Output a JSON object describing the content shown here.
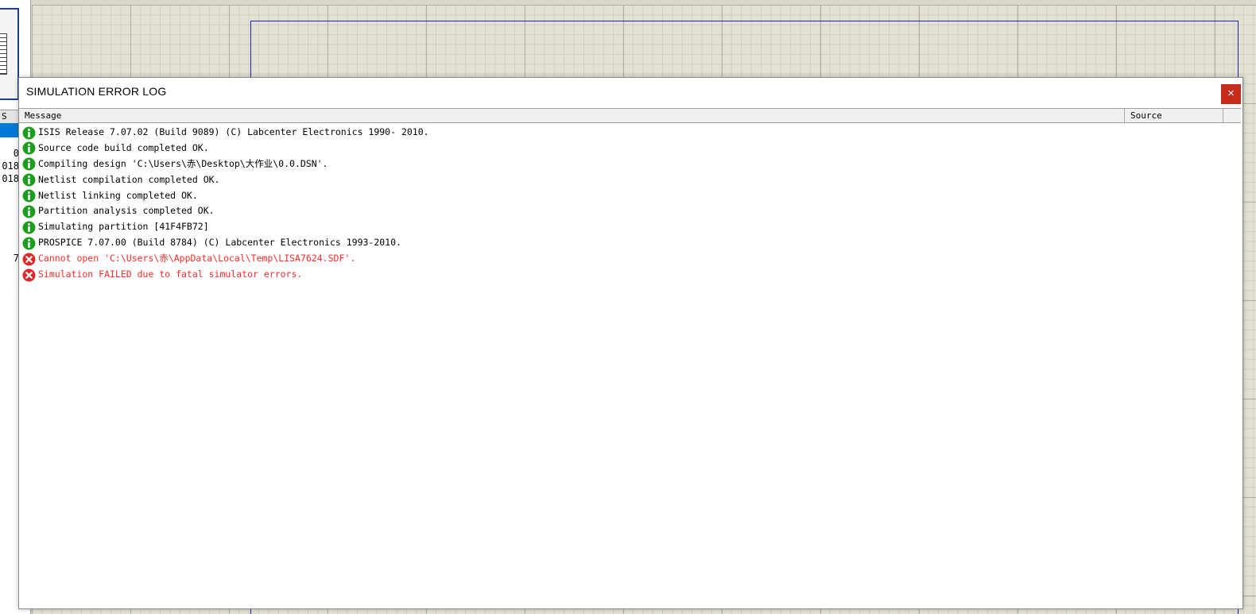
{
  "background": {
    "left_panel": {
      "tab_label": "S",
      "clipped_texts": [
        "0",
        "018",
        "018",
        "7"
      ]
    }
  },
  "dialog": {
    "title": "SIMULATION ERROR LOG",
    "close_symbol": "×",
    "columns": {
      "message": "Message",
      "source": "Source"
    },
    "messages": [
      {
        "level": "info",
        "icon": "info-icon",
        "text": "ISIS Release 7.07.02 (Build 9089) (C) Labcenter Electronics 1990- 2010."
      },
      {
        "level": "info",
        "icon": "info-icon",
        "text": "Source code build completed OK."
      },
      {
        "level": "info",
        "icon": "info-icon",
        "text": "Compiling design 'C:\\Users\\赤\\Desktop\\大作业\\0.0.DSN'."
      },
      {
        "level": "info",
        "icon": "info-icon",
        "text": "Netlist compilation completed OK."
      },
      {
        "level": "info",
        "icon": "info-icon",
        "text": "Netlist linking completed OK."
      },
      {
        "level": "info",
        "icon": "info-icon",
        "text": "Partition analysis completed OK."
      },
      {
        "level": "info",
        "icon": "info-icon",
        "text": "Simulating partition [41F4FB72]"
      },
      {
        "level": "info",
        "icon": "info-icon",
        "text": "PROSPICE 7.07.00 (Build 8784) (C) Labcenter Electronics 1993-2010."
      },
      {
        "level": "error",
        "icon": "error-icon",
        "text": "Cannot open 'C:\\Users\\赤\\AppData\\Local\\Temp\\LISA7624.SDF'."
      },
      {
        "level": "error",
        "icon": "error-icon",
        "text": "Simulation FAILED due to fatal simulator errors."
      }
    ]
  },
  "colors": {
    "info_icon": "#1e9c1e",
    "error_icon": "#e0262a",
    "error_text": "#ff2a2a",
    "close_button": "#c42b1c",
    "grid_background": "#e2e2d4",
    "frame": "#2020c0"
  }
}
